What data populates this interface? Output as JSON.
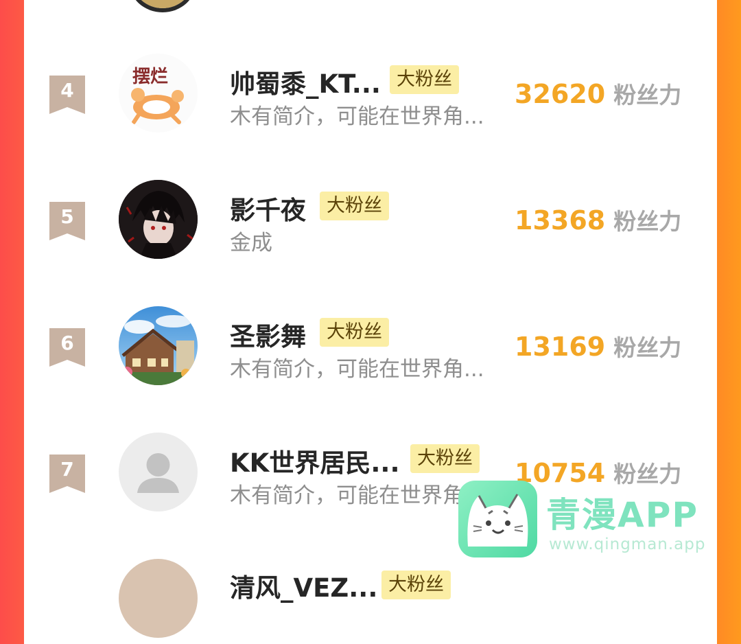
{
  "rows": [
    {
      "rank": "4",
      "name": "帅蜀黍_KT...",
      "badge": "大粉丝",
      "bio": "木有简介，可能在世界角...",
      "score": "32620",
      "unit": "粉丝力",
      "avatar_text": "摆烂"
    },
    {
      "rank": "5",
      "name": "影千夜",
      "badge": "大粉丝",
      "bio": "金成",
      "score": "13368",
      "unit": "粉丝力"
    },
    {
      "rank": "6",
      "name": "圣影舞",
      "badge": "大粉丝",
      "bio": "木有简介，可能在世界角...",
      "score": "13169",
      "unit": "粉丝力"
    },
    {
      "rank": "7",
      "name": "KK世界居民...",
      "badge": "大粉丝",
      "bio": "木有简介，可能在世界角...",
      "score": "10754",
      "unit": "粉丝力"
    },
    {
      "name": "清风_VEZ...",
      "badge": "大粉丝"
    }
  ],
  "watermark": {
    "title": "青漫APP",
    "url": "www.qingman.app"
  },
  "colors": {
    "left_edge": "#fd4d4a",
    "right_edge": "#ff9a1e",
    "score": "#f3a625",
    "badge_bg": "#fbeea5",
    "rank_ribbon": "#c8b2a2"
  }
}
